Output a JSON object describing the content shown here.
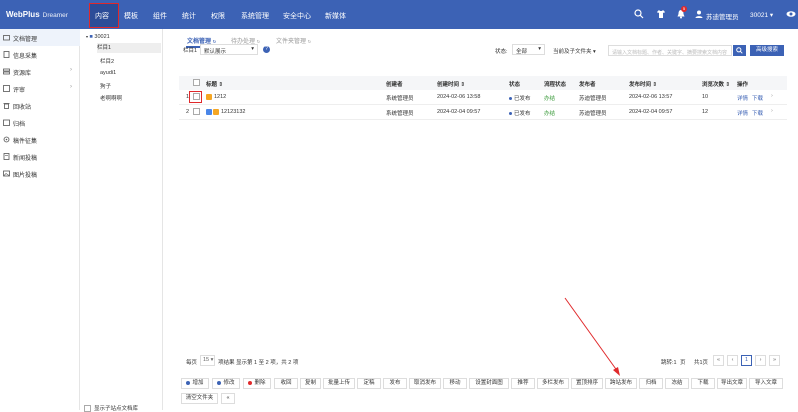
{
  "app": {
    "logo": "WebPlus",
    "logo_sub": "Dreamer"
  },
  "top_nav": {
    "items": [
      "内容",
      "模板",
      "组件",
      "统计",
      "权限",
      "系统管理",
      "安全中心",
      "新媒体"
    ],
    "badge": "5",
    "user": "苏迪管理员",
    "site": "30021"
  },
  "sidebar": {
    "items": [
      {
        "label": "文档管理"
      },
      {
        "label": "信息采集"
      },
      {
        "label": "资源库"
      },
      {
        "label": "评审"
      },
      {
        "label": "回收站"
      },
      {
        "label": "归档"
      },
      {
        "label": "稿件征集"
      },
      {
        "label": "新闻投稿"
      },
      {
        "label": "图片投稿"
      }
    ]
  },
  "tree": {
    "root": "30021",
    "nodes": [
      "栏目1",
      "栏目2",
      "ayudi1",
      "狗子",
      "老啊啊啊"
    ]
  },
  "tabs": [
    "文档管理",
    "待办处理",
    "文件夹管理"
  ],
  "filter": {
    "column_label": "栏目1",
    "display_select": "默认展示",
    "status_label": "状态:",
    "status_value": "全部",
    "scope_select": "当前及子文件夹",
    "search_placeholder": "请输入文档标题、作者、关键字、摘要搜索文档内容",
    "adv_search": "高级搜索"
  },
  "table": {
    "headers": [
      "标题",
      "创建者",
      "创建时间",
      "状态",
      "流程状态",
      "发布者",
      "发布时间",
      "浏览次数",
      "操作"
    ],
    "rows": [
      {
        "num": "1",
        "title": "1212",
        "creator": "系统管理员",
        "created": "2024-02-06 13:58",
        "status": "已发布",
        "flow": "办结",
        "publisher": "苏迪管理员",
        "published": "2024-02-06 13:57",
        "views": "10",
        "act1": "详情",
        "act2": "下载"
      },
      {
        "num": "2",
        "title": "12123132",
        "creator": "系统管理员",
        "created": "2024-02-04 09:57",
        "status": "已发布",
        "flow": "办结",
        "publisher": "苏迪管理员",
        "published": "2024-02-04 09:57",
        "views": "12",
        "act1": "详情",
        "act2": "下载"
      }
    ]
  },
  "pagination": {
    "per_page_label": "每页",
    "per_page": "15",
    "summary": "项结果 显示第 1 至 2 项，共 2 项",
    "goto_label": "跳转:1",
    "page_label": "页",
    "total_label": "共1页",
    "current": "1"
  },
  "actions": [
    "增加",
    "修改",
    "删除",
    "收回",
    "复制",
    "批量上传",
    "定稿",
    "发布",
    "取消发布",
    "移动",
    "设置封面图",
    "推荐",
    "多栏发布",
    "置顶排序",
    "跨站发布",
    "归档",
    "冻结",
    "下载",
    "导出文章",
    "导入文章",
    "清空文件夹",
    "«"
  ],
  "bottom": {
    "show_sub": "显示子站点文档库"
  },
  "colors": {
    "primary": "#3c62b5",
    "highlight": "#e0292b"
  }
}
